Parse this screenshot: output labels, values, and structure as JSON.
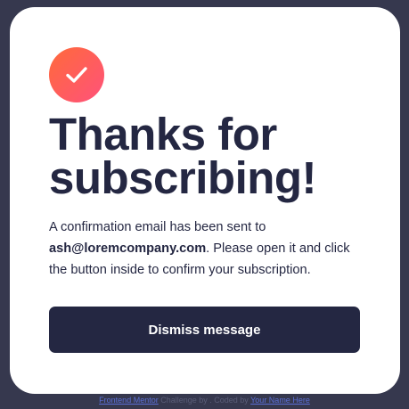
{
  "icon": {
    "name": "checkmark-icon",
    "gradient_start": "#ff6a3a",
    "gradient_end": "#ff527b"
  },
  "title": {
    "line1": "Thanks for",
    "line2": "subscribing!"
  },
  "message": {
    "prefix": "A confirmation email has been sent to ",
    "email": "ash@loremcompany.com",
    "suffix": ". Please open it and click the button inside to confirm your subscription."
  },
  "dismiss_label": "Dismiss message",
  "attribution": {
    "link1": "Frontend Mentor",
    "middle": " Challenge by . Coded by ",
    "link2": "Your Name Here"
  },
  "colors": {
    "background": "#36384e",
    "card": "#ffffff",
    "text": "#242742",
    "button": "#242742"
  }
}
